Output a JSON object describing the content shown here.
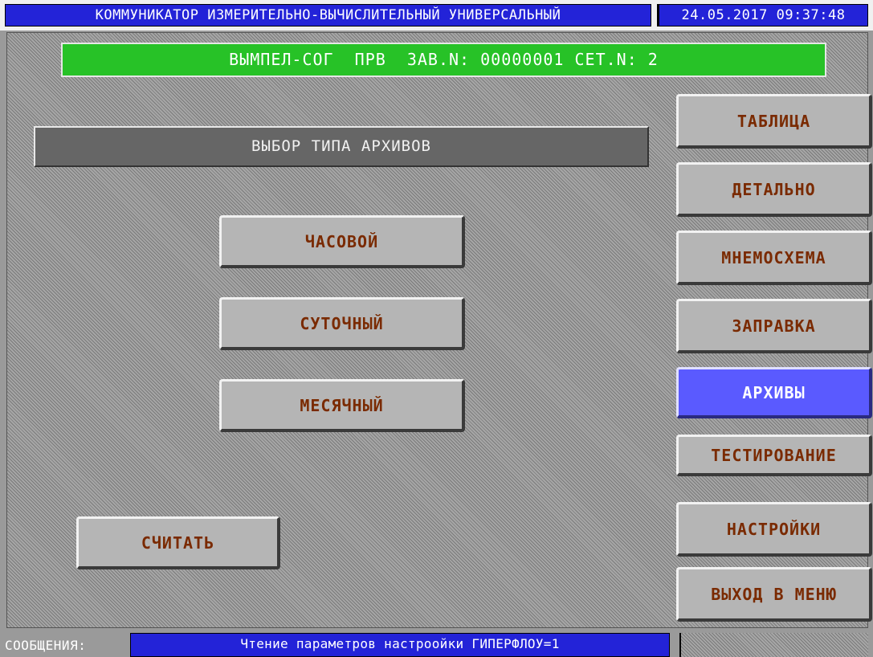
{
  "window": {
    "title": "КОММУНИКАТОР ИЗМЕРИТЕЛЬНО-ВЫЧИСЛИТЕЛЬНЫЙ УНИВЕРСАЛЬНЫЙ",
    "datetime": "24.05.2017 09:37:48"
  },
  "device": {
    "banner": "ВЫМПЕЛ-СОГ  ПРВ  ЗАВ.N: 00000001 СЕТ.N: 2"
  },
  "section": {
    "title": "ВЫБОР ТИПА АРХИВОВ"
  },
  "archive_types": [
    {
      "label": "ЧАСОВОЙ"
    },
    {
      "label": "СУТОЧНЫЙ"
    },
    {
      "label": "МЕСЯЧНЫЙ"
    }
  ],
  "read_button": {
    "label": "СЧИТАТЬ"
  },
  "nav": [
    {
      "label": "ТАБЛИЦА",
      "active": false
    },
    {
      "label": "ДЕТАЛЬНО",
      "active": false
    },
    {
      "label": "МНЕМОСХЕМА",
      "active": false
    },
    {
      "label": "ЗАПРАВКА",
      "active": false
    },
    {
      "label": "АРХИВЫ",
      "active": true
    },
    {
      "label": "ТЕСТИРОВАНИЕ",
      "active": false
    },
    {
      "label": "НАСТРОЙКИ",
      "active": false
    },
    {
      "label": "ВЫХОД В МЕНЮ",
      "active": false
    }
  ],
  "status": {
    "label": "СООБЩЕНИЯ:",
    "message": "Чтение параметров настроойки ГИПЕРФЛОУ=1"
  },
  "colors": {
    "title_bg": "#2323d8",
    "banner_bg": "#27c227",
    "button_bg": "#b5b5b5",
    "button_text": "#7a2a00",
    "active_bg": "#5a5aff"
  }
}
